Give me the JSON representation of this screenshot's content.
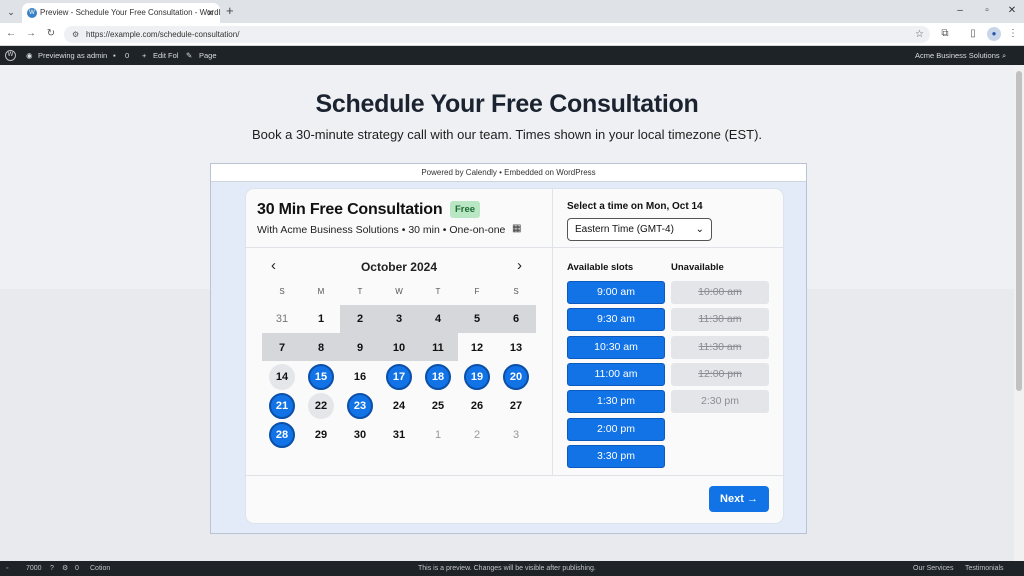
{
  "browser": {
    "tab_title": "Preview - Schedule Your Free Consultation - WordPress",
    "url": "https://example.com/schedule-consultation/"
  },
  "wpbar": {
    "previewing": "Previewing as admin",
    "comments_count": "0",
    "edit_label": "Edit Fol",
    "page_label": "Page",
    "site_name": "Acme Business Solutions"
  },
  "page": {
    "title": "Schedule Your Free Consultation",
    "subtitle": "Book a 30-minute strategy call with our team. Times shown in your local timezone (EST)."
  },
  "embed": {
    "powered_prefix": "Powered by ",
    "powered_brand": "Calendly",
    "embedded_prefix": " • Embedded on ",
    "embedded_platform": "WordPress"
  },
  "event": {
    "title": "30 Min Free Consultation",
    "badge": "Free",
    "meta": "With Acme Business Solutions • 30 min • One-on-one"
  },
  "picker": {
    "label": "Select a time on Mon, Oct 14",
    "timezone": "Eastern Time (GMT-4)"
  },
  "calendar": {
    "month": "October 2024",
    "weekdays": [
      "S",
      "M",
      "T",
      "W",
      "T",
      "F",
      "S"
    ],
    "rows": [
      [
        {
          "d": "31",
          "s": "muted"
        },
        {
          "d": "1",
          "s": "normal"
        },
        {
          "d": "2",
          "s": "normal"
        },
        {
          "d": "3",
          "s": "normal"
        },
        {
          "d": "4",
          "s": "normal"
        },
        {
          "d": "5",
          "s": "normal"
        },
        {
          "d": "6",
          "s": "normal"
        }
      ],
      [
        {
          "d": "7",
          "s": "normal"
        },
        {
          "d": "8",
          "s": "normal"
        },
        {
          "d": "9",
          "s": "normal"
        },
        {
          "d": "10",
          "s": "normal"
        },
        {
          "d": "11",
          "s": "normal"
        },
        {
          "d": "12",
          "s": "normal"
        },
        {
          "d": "13",
          "s": "normal"
        }
      ],
      [
        {
          "d": "14",
          "s": "hover"
        },
        {
          "d": "15",
          "s": "avail"
        },
        {
          "d": "16",
          "s": "normal"
        },
        {
          "d": "17",
          "s": "avail"
        },
        {
          "d": "18",
          "s": "avail"
        },
        {
          "d": "19",
          "s": "avail"
        },
        {
          "d": "20",
          "s": "avail"
        }
      ],
      [
        {
          "d": "21",
          "s": "avail"
        },
        {
          "d": "22",
          "s": "hover"
        },
        {
          "d": "23",
          "s": "avail"
        },
        {
          "d": "24",
          "s": "normal"
        },
        {
          "d": "25",
          "s": "normal"
        },
        {
          "d": "26",
          "s": "normal"
        },
        {
          "d": "27",
          "s": "normal"
        }
      ],
      [
        {
          "d": "28",
          "s": "avail"
        },
        {
          "d": "29",
          "s": "normal"
        },
        {
          "d": "30",
          "s": "normal"
        },
        {
          "d": "31",
          "s": "normal"
        },
        {
          "d": "1",
          "s": "grey"
        },
        {
          "d": "2",
          "s": "grey"
        },
        {
          "d": "3",
          "s": "grey"
        }
      ]
    ]
  },
  "slots": {
    "available_header": "Available slots",
    "unavailable_header": "Unavailable",
    "available": [
      "9:00 am",
      "9:30 am",
      "10:30 am",
      "11:00 am",
      "1:30 pm",
      "2:00 pm",
      "3:30 pm"
    ],
    "unavailable": [
      "10:00 am",
      "11:30 am",
      "11:30 am",
      "12:00 pm",
      "2:30 pm"
    ]
  },
  "actions": {
    "next_label": "Next"
  },
  "footer": {
    "left": [
      "7000",
      "0",
      "Cotion"
    ],
    "notice": "This is a preview. Changes will be visible after publishing.",
    "right": [
      "Our Services",
      "Testimonials"
    ]
  }
}
